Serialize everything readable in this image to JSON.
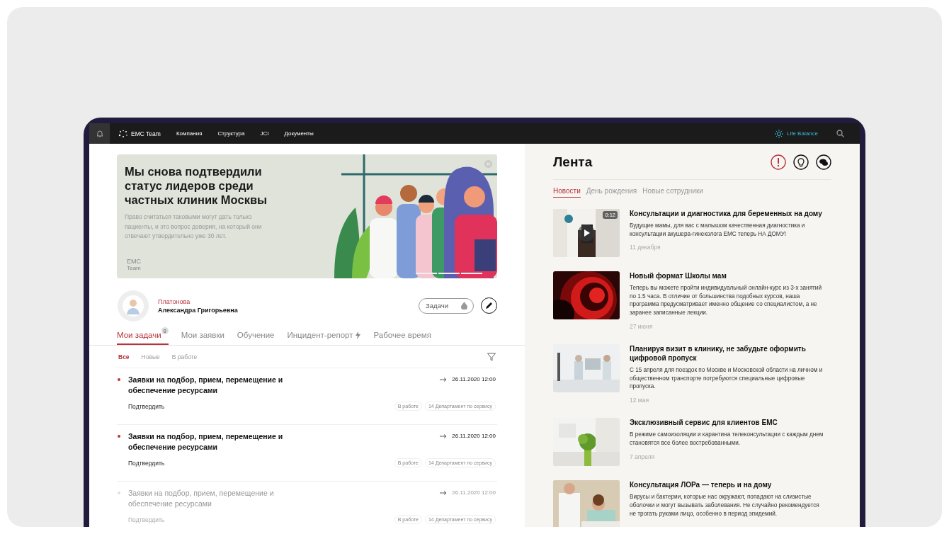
{
  "nav": {
    "brand": "EMC Team",
    "menu": [
      {
        "label": "Компания"
      },
      {
        "label": "Структура"
      },
      {
        "label": "JCI"
      },
      {
        "label": "Документы"
      }
    ],
    "life_balance": "Life Balance"
  },
  "banner": {
    "title": "Мы снова подтвердили статус лидеров среди частных клиник Москвы",
    "text": "Право считаться таковыми могут дать только пациенты, и это вопрос доверия, на который они отвечают утвердительно уже 30 лет.",
    "logo": "EMC",
    "logo_sub": "Team"
  },
  "profile": {
    "surname": "Платонова",
    "name": "Александра Григорьевна",
    "tasks_button": "Задачи"
  },
  "tabs": [
    {
      "label": "Мои задачи",
      "selected": true,
      "badge": "0",
      "kind": "badge"
    },
    {
      "label": "Мои заявки",
      "selected": false,
      "kind": "plain"
    },
    {
      "label": "Обучение",
      "selected": false,
      "kind": "plain"
    },
    {
      "label": "Инцидент-репорт",
      "selected": false,
      "kind": "bolt"
    },
    {
      "label": "Рабочее время",
      "selected": false,
      "kind": "plain"
    }
  ],
  "filters": [
    {
      "label": "Все",
      "selected": true
    },
    {
      "label": "Новые",
      "selected": false
    },
    {
      "label": "В работе",
      "selected": false
    }
  ],
  "tasks": [
    {
      "title": "Заявки на подбор, прием, перемещение и обеспечение ресурсами",
      "due": "26.11.2020 12:00",
      "action": "Подтвердить",
      "status": "В работе",
      "department": "14 Департамент по сервису",
      "muted": false
    },
    {
      "title": "Заявки на подбор, прием, перемещение и обеспечение ресурсами",
      "due": "26.11.2020 12:00",
      "action": "Подтвердить",
      "status": "В работе",
      "department": "14 Департамент по сервису",
      "muted": false
    },
    {
      "title": "Заявки на подбор, прием, перемещение и обеспечение ресурсами",
      "due": "26.11.2020 12:00",
      "action": "Подтвердить",
      "status": "В работе",
      "department": "14 Департамент по сервису",
      "muted": true
    }
  ],
  "feed": {
    "title": "Лента",
    "tabs": [
      {
        "label": "Новости",
        "selected": true
      },
      {
        "label": "День рождения",
        "selected": false
      },
      {
        "label": "Новые сотрудники",
        "selected": false
      }
    ],
    "news": [
      {
        "kind": "video",
        "duration": "0:12",
        "title": "Консультации и диагностика для беременных на дому",
        "text": "Будущие мамы, для вас с малышом качественная диагностика и консультации акушера-гинеколога ЕМС теперь НА ДОМУ!",
        "date": "11 декабря"
      },
      {
        "kind": "article",
        "title": "Новый формат Школы мам",
        "text": "Теперь вы можете пройти индивидуальный онлайн-курс из 3-х занятий по 1.5 часа. В отличие от большинства подобных курсов, наша программа предусматривает именно общение со специалистом, а не заранее записанные лекции.",
        "date": "27 июня"
      },
      {
        "kind": "article",
        "title": "Планируя визит в клинику, не забудьте оформить цифровой пропуск",
        "text": "С 15 апреля для поездок по Москве и Московской области на личном и общественном транспорте потребуются специальные цифровые пропуска.",
        "date": "12 мая"
      },
      {
        "kind": "article",
        "title": "Эксклюзивный сервис для клиентов ЕМС",
        "text": "В режиме самоизоляции и карантина телеконсультации с каждым днем становятся все более востребованными.",
        "date": "7 апреля"
      },
      {
        "kind": "article",
        "title": "Консультация ЛОРа — теперь и на дому",
        "text": "Вирусы и бактерии, которые нас окружают, попадают на слизистые оболочки и могут вызывать заболевания. Не случайно рекомендуется не трогать руками лицо, особенно в период эпидемий."
      }
    ]
  }
}
